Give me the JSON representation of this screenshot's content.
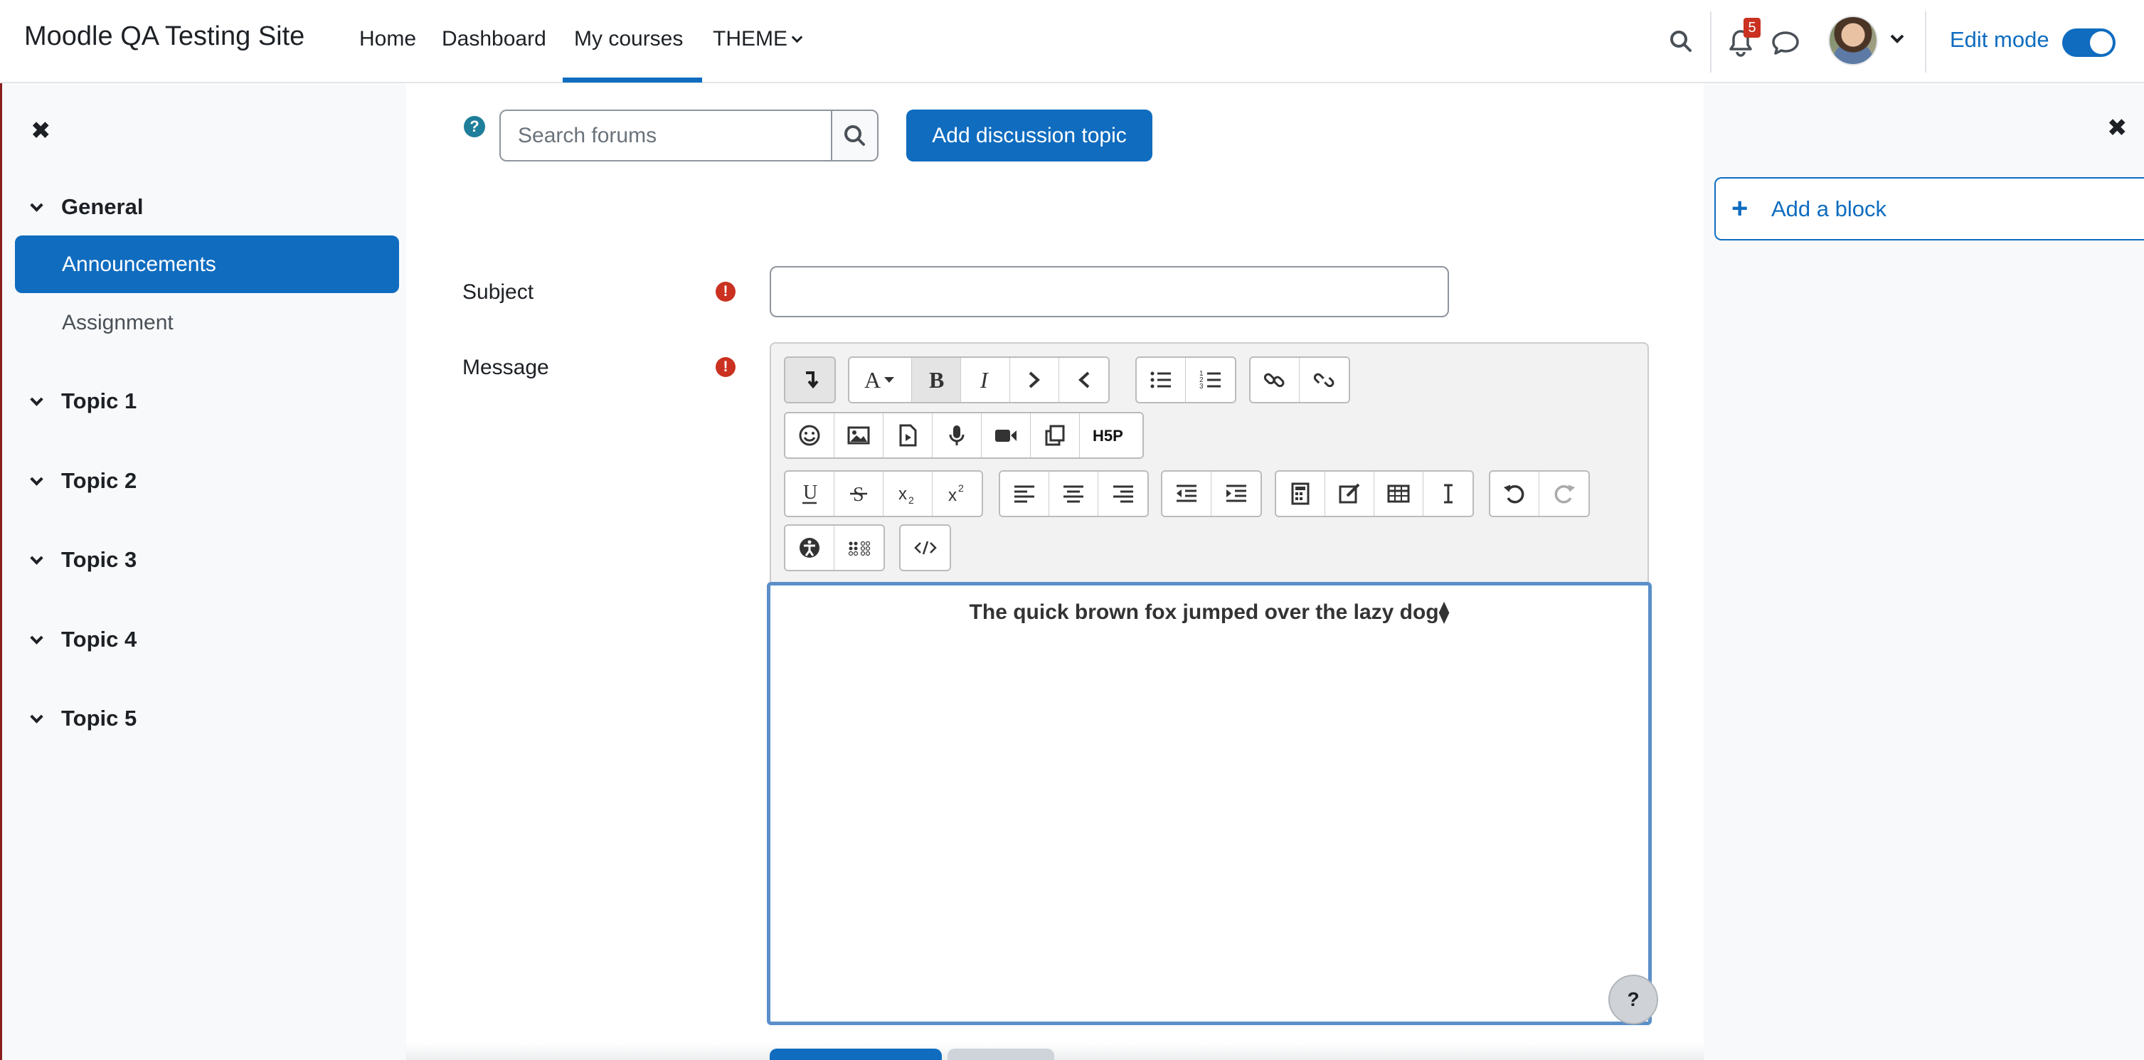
{
  "navbar": {
    "brand": "Moodle QA Testing Site",
    "items": [
      {
        "label": "Home"
      },
      {
        "label": "Dashboard"
      },
      {
        "label": "My courses"
      },
      {
        "label": "THEME"
      }
    ],
    "notification_count": "5",
    "edit_mode_label": "Edit mode",
    "edit_mode_on": true
  },
  "drawer": {
    "sections": [
      {
        "label": "General"
      },
      {
        "label": "Topic 1"
      },
      {
        "label": "Topic 2"
      },
      {
        "label": "Topic 3"
      },
      {
        "label": "Topic 4"
      },
      {
        "label": "Topic 5"
      }
    ],
    "links": [
      {
        "label": "Announcements",
        "active": true
      },
      {
        "label": "Assignment",
        "active": false
      }
    ]
  },
  "forum": {
    "search_placeholder": "Search forums",
    "add_topic_label": "Add discussion topic"
  },
  "form": {
    "subject_label": "Subject",
    "subject_value": "",
    "message_label": "Message",
    "message_text": "The quick brown fox jumped over the lazy dog⧫"
  },
  "right_drawer": {
    "add_block_label": "Add a block"
  },
  "colors": {
    "primary": "#0f6cbf",
    "required": "#ca3120",
    "editor_focus": "#5b8fc9"
  }
}
